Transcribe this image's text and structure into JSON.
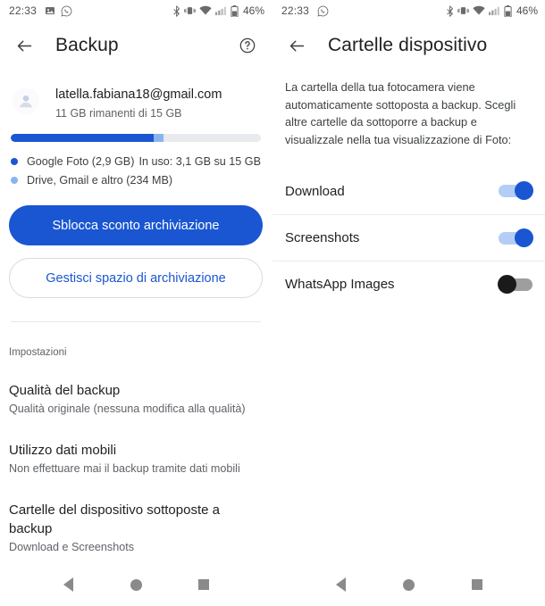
{
  "status_bar": {
    "time": "22:33",
    "battery_text": "46%",
    "left_icons": [
      "image-icon",
      "whatsapp-icon"
    ],
    "right_icons": [
      "bluetooth-icon",
      "vibrate-icon",
      "wifi-icon",
      "signal-icon",
      "battery-icon"
    ]
  },
  "left_panel": {
    "appbar": {
      "back_icon": "back-arrow-icon",
      "title": "Backup",
      "help_icon": "help-circle-icon"
    },
    "account": {
      "avatar": "account-avatar",
      "email": "latella.fabiana18@gmail.com",
      "storage_remaining": "11 GB rimanenti di 15 GB"
    },
    "storage": {
      "segments": [
        {
          "label": "Google Foto (2,9 GB)",
          "color": "#1a56d2",
          "percent": 57
        },
        {
          "label": "Drive, Gmail e altro (234 MB)",
          "color": "#8ab4f0",
          "percent": 4
        }
      ],
      "track_color": "#e8eaed",
      "usage_text": "In uso: 3,1 GB su 15 GB"
    },
    "buttons": {
      "primary": "Sblocca sconto archiviazione",
      "secondary": "Gestisci spazio di archiviazione"
    },
    "settings_header": "Impostazioni",
    "settings": [
      {
        "title": "Qualità del backup",
        "subtitle": "Qualità originale (nessuna modifica alla qualità)"
      },
      {
        "title": "Utilizzo dati mobili",
        "subtitle": "Non effettuare mai il backup tramite dati mobili"
      },
      {
        "title": "Cartelle del dispositivo sottoposte a backup",
        "subtitle": "Download e Screenshots"
      }
    ]
  },
  "right_panel": {
    "appbar": {
      "back_icon": "back-arrow-icon",
      "title": "Cartelle dispositivo"
    },
    "description": "La cartella della tua fotocamera viene automaticamente sottoposta a backup. Scegli altre cartelle da sottoporre a backup e visualizzale nella tua visualizzazione di Foto:",
    "folders": [
      {
        "label": "Download",
        "enabled": true
      },
      {
        "label": "Screenshots",
        "enabled": true
      },
      {
        "label": "WhatsApp Images",
        "enabled": false
      }
    ]
  },
  "nav_bar": {
    "back": "nav-back-icon",
    "home": "nav-home-icon",
    "recents": "nav-recents-icon"
  },
  "colors": {
    "accent": "#1a56d2",
    "accent_light": "#8ab4f0",
    "text_primary": "#202124",
    "text_secondary": "#5f6368"
  }
}
